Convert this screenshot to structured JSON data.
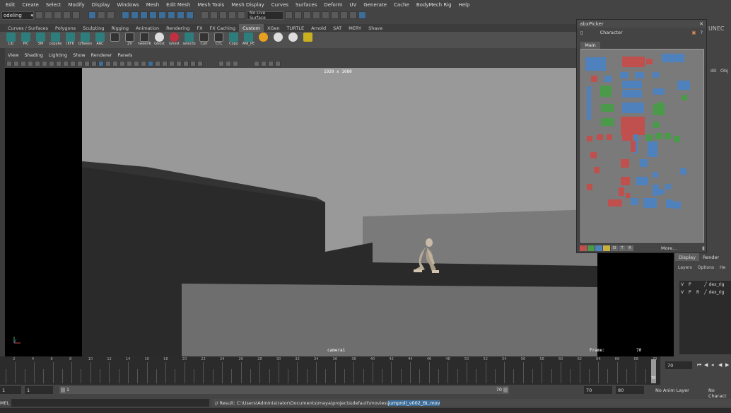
{
  "menubar": [
    "Edit",
    "Create",
    "Select",
    "Modify",
    "Display",
    "Windows",
    "Mesh",
    "Edit Mesh",
    "Mesh Tools",
    "Mesh Display",
    "Curves",
    "Surfaces",
    "Deform",
    "UV",
    "Generate",
    "Cache",
    "BodyMech Rig",
    "Help"
  ],
  "status_line": {
    "mode_menu": "odeling",
    "live_surface": "No Live Surface"
  },
  "shelf_tabs": [
    "Curves / Surfaces",
    "Polygons",
    "Sculpting",
    "Rigging",
    "Animation",
    "Rendering",
    "FX",
    "FX Caching",
    "Custom",
    "XGen",
    "TURTLE",
    "Arnold",
    "SAT",
    "MERY",
    "Shave"
  ],
  "shelf_active_tab": "Custom",
  "shelf_items": [
    {
      "label": "Lib",
      "icon": "teal"
    },
    {
      "label": "PIC",
      "icon": "teal"
    },
    {
      "label": "SM",
      "icon": "teal"
    },
    {
      "label": "copyke",
      "icon": "teal"
    },
    {
      "label": "IKFK",
      "icon": "teal"
    },
    {
      "label": "QTween",
      "icon": "teal"
    },
    {
      "label": "ARC",
      "icon": "teal"
    },
    {
      "label": "",
      "icon": "dark"
    },
    {
      "label": "ZV",
      "icon": "dark"
    },
    {
      "label": "tweenK",
      "icon": "dark"
    },
    {
      "label": "Ghost",
      "icon": "white"
    },
    {
      "label": "Ghost",
      "icon": "red"
    },
    {
      "label": "selectb",
      "icon": "teal"
    },
    {
      "label": "Curl",
      "icon": "dark"
    },
    {
      "label": "CTL",
      "icon": "dark"
    },
    {
      "label": "Copy",
      "icon": "teal"
    },
    {
      "label": "ANI_PE",
      "icon": "teal"
    },
    {
      "label": "",
      "icon": "orange"
    },
    {
      "label": "",
      "icon": "white"
    },
    {
      "label": "",
      "icon": "white"
    },
    {
      "label": "",
      "icon": "yellow"
    }
  ],
  "panel_menu": [
    "View",
    "Shading",
    "Lighting",
    "Show",
    "Renderer",
    "Panels"
  ],
  "viewport": {
    "resolution": "1920 x 1080",
    "camera": "camera1",
    "frame_label": "Frame:",
    "frame_value": "70"
  },
  "picker": {
    "title": "abxPicker",
    "character": "Character",
    "tab": "Main",
    "more": "More...",
    "footer_buttons": [
      "SI",
      "T",
      "R"
    ],
    "swatch_colors": [
      "#c0504d",
      "#4a9a4a",
      "#4f81bd",
      "#c8b040"
    ]
  },
  "right_panel": {
    "label": "UNEC",
    "items": [
      "dit",
      "Obj"
    ]
  },
  "layer_panel": {
    "tabs": [
      "Display",
      "Render"
    ],
    "active_tab": "Display",
    "menu": [
      "Layers",
      "Options",
      "He"
    ],
    "rows": [
      {
        "v": "V",
        "p": "P",
        "r": "",
        "name": "dex_rig"
      },
      {
        "v": "V",
        "p": "P",
        "r": "R",
        "name": "dex_rig"
      }
    ]
  },
  "timeline": {
    "start": 1,
    "end": 70,
    "current": 70,
    "labels": [
      "2",
      "4",
      "6",
      "8",
      "10",
      "12",
      "14",
      "16",
      "18",
      "20",
      "22",
      "24",
      "26",
      "28",
      "30",
      "32",
      "34",
      "36",
      "38",
      "40",
      "42",
      "44",
      "46",
      "48",
      "50",
      "52",
      "54",
      "56",
      "58",
      "60",
      "62",
      "64",
      "66",
      "68",
      "70"
    ]
  },
  "time_ctrl": {
    "current": "70"
  },
  "range": {
    "start_field": "1",
    "start_field2": "1",
    "range_start_label": "1",
    "range_end_label": "70",
    "end_field": "70",
    "end_field2": "80",
    "anim_layer": "No Anim Layer",
    "character": "No Charact"
  },
  "command": {
    "mel": "MEL",
    "result_prefix": "// Result: C:\\Users\\Administrator\\Documents\\maya\\projects\\default\\movies\\",
    "result_file": "jumproll_v002_BL.mov"
  }
}
